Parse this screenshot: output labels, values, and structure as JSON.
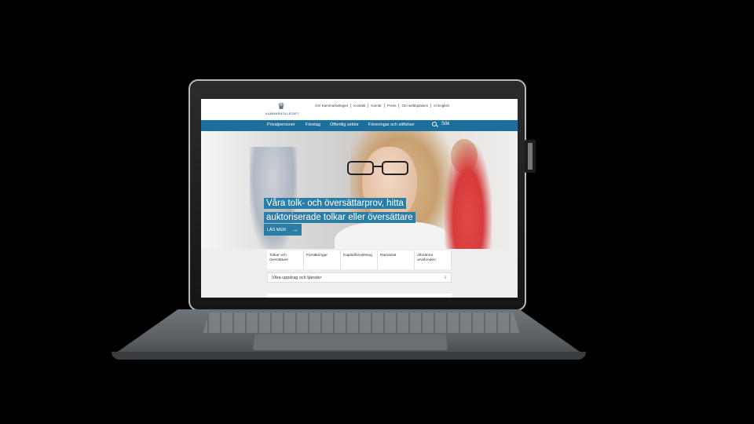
{
  "site": {
    "logo_text": "KAMMARKOLLEGIET",
    "top_links": [
      "Om Kammarkollegiet",
      "Kontakt",
      "Karriär",
      "Press",
      "Om webbplatsen",
      "In English"
    ],
    "nav": {
      "items": [
        "Privatpersoner",
        "Företag",
        "Offentlig sektor",
        "Föreningar och stiftelser"
      ],
      "search_label": "Sök"
    },
    "hero": {
      "headline_line1": "Våra tolk- och översättarprov, hitta",
      "headline_line2": "auktoriserade tolkar eller översättare",
      "read_more_label": "LÄS MER",
      "arrow": "→"
    },
    "tabs": [
      {
        "label": "Tolkar och översättare"
      },
      {
        "label": "Försäkringar"
      },
      {
        "label": "Kapitalförvaltning"
      },
      {
        "label": "Ramavtal"
      },
      {
        "label": "Allmänna arvsfonden"
      }
    ],
    "dropdown": {
      "label": "Våra uppdrag och tjänster",
      "arrow": "⇩"
    }
  },
  "colors": {
    "nav_blue": "#1d6f9b",
    "hero_accent": "#2a7ea6"
  }
}
